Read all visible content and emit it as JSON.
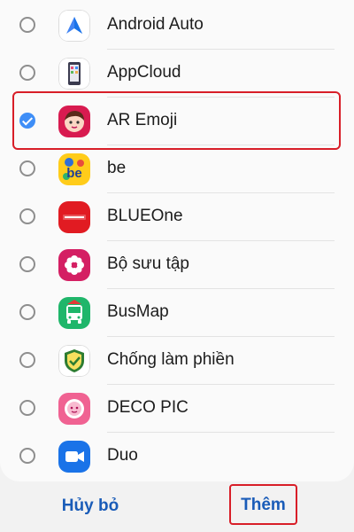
{
  "apps": [
    {
      "label": "Android Auto",
      "icon": "android-auto-icon",
      "selected": false
    },
    {
      "label": "AppCloud",
      "icon": "appcloud-icon",
      "selected": false
    },
    {
      "label": "AR Emoji",
      "icon": "ar-emoji-icon",
      "selected": true
    },
    {
      "label": "be",
      "icon": "be-icon",
      "selected": false
    },
    {
      "label": "BLUEOne",
      "icon": "blueone-icon",
      "selected": false
    },
    {
      "label": "Bộ sưu tập",
      "icon": "gallery-icon",
      "selected": false
    },
    {
      "label": "BusMap",
      "icon": "busmap-icon",
      "selected": false
    },
    {
      "label": "Chống làm phiền",
      "icon": "do-not-disturb-icon",
      "selected": false
    },
    {
      "label": "DECO PIC",
      "icon": "deco-pic-icon",
      "selected": false
    },
    {
      "label": "Duo",
      "icon": "duo-icon",
      "selected": false
    }
  ],
  "footer": {
    "cancel_label": "Hủy bỏ",
    "add_label": "Thêm"
  },
  "colors": {
    "accent": "#3e8ef7",
    "button_text": "#1a5cb8",
    "highlight": "#d81e28"
  }
}
